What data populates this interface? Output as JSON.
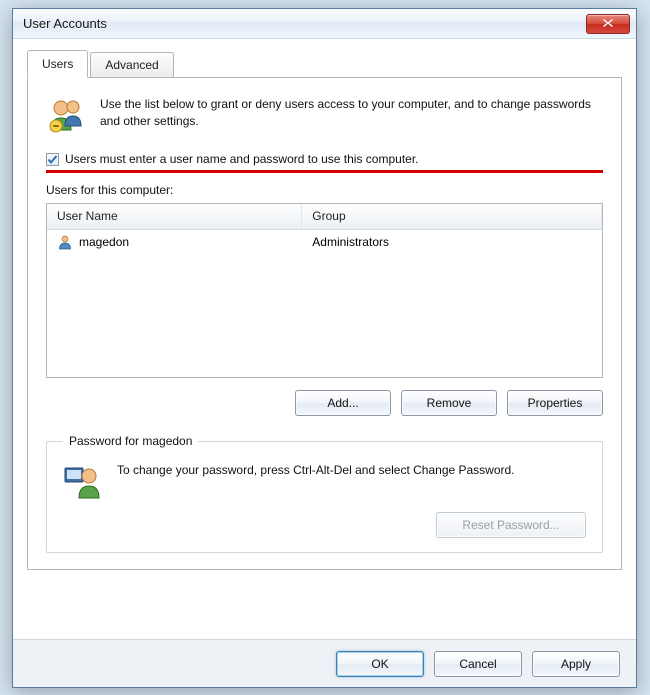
{
  "window": {
    "title": "User Accounts"
  },
  "tabs": {
    "users": "Users",
    "advanced": "Advanced"
  },
  "intro_text": "Use the list below to grant or deny users access to your computer, and to change passwords and other settings.",
  "checkbox": {
    "label": "Users must enter a user name and password to use this computer.",
    "checked": true
  },
  "list": {
    "label": "Users for this computer:",
    "columns": {
      "username": "User Name",
      "group": "Group"
    },
    "rows": [
      {
        "username": "magedon",
        "group": "Administrators"
      }
    ]
  },
  "buttons": {
    "add": "Add...",
    "remove": "Remove",
    "properties": "Properties",
    "ok": "OK",
    "cancel": "Cancel",
    "apply": "Apply",
    "reset_password": "Reset Password..."
  },
  "password_group": {
    "legend": "Password for magedon",
    "text": "To change your password, press Ctrl-Alt-Del and select Change Password."
  }
}
